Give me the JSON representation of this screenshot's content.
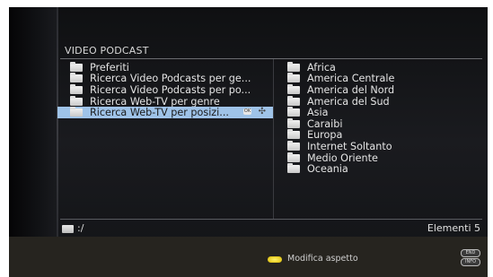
{
  "header": {
    "title": "VIDEO PODCAST"
  },
  "left_list": {
    "items": [
      {
        "label": "Preferiti",
        "selected": false
      },
      {
        "label": "Ricerca Video Podcasts per ge...",
        "selected": false
      },
      {
        "label": "Ricerca Video Podcasts per po...",
        "selected": false
      },
      {
        "label": "Ricerca Web-TV per genre",
        "selected": false
      },
      {
        "label": "Ricerca Web-TV per posizi...",
        "selected": true
      }
    ],
    "selected_icons": {
      "ok": "OK",
      "nav": "✣"
    }
  },
  "right_list": {
    "items": [
      {
        "label": "Africa"
      },
      {
        "label": "America Centrale"
      },
      {
        "label": "America del Nord"
      },
      {
        "label": "America del Sud"
      },
      {
        "label": "Asia"
      },
      {
        "label": "Caraibi"
      },
      {
        "label": "Europa"
      },
      {
        "label": "Internet Soltanto"
      },
      {
        "label": "Medio Oriente"
      },
      {
        "label": "Oceania"
      }
    ]
  },
  "status": {
    "path": ":/",
    "count": "Elementi 5"
  },
  "footer": {
    "action_label": "Modifica aspetto",
    "end_key": "END",
    "info_key": "INFO",
    "yellow_color": "#f2e13a",
    "selection_color": "#9fc3e8"
  }
}
